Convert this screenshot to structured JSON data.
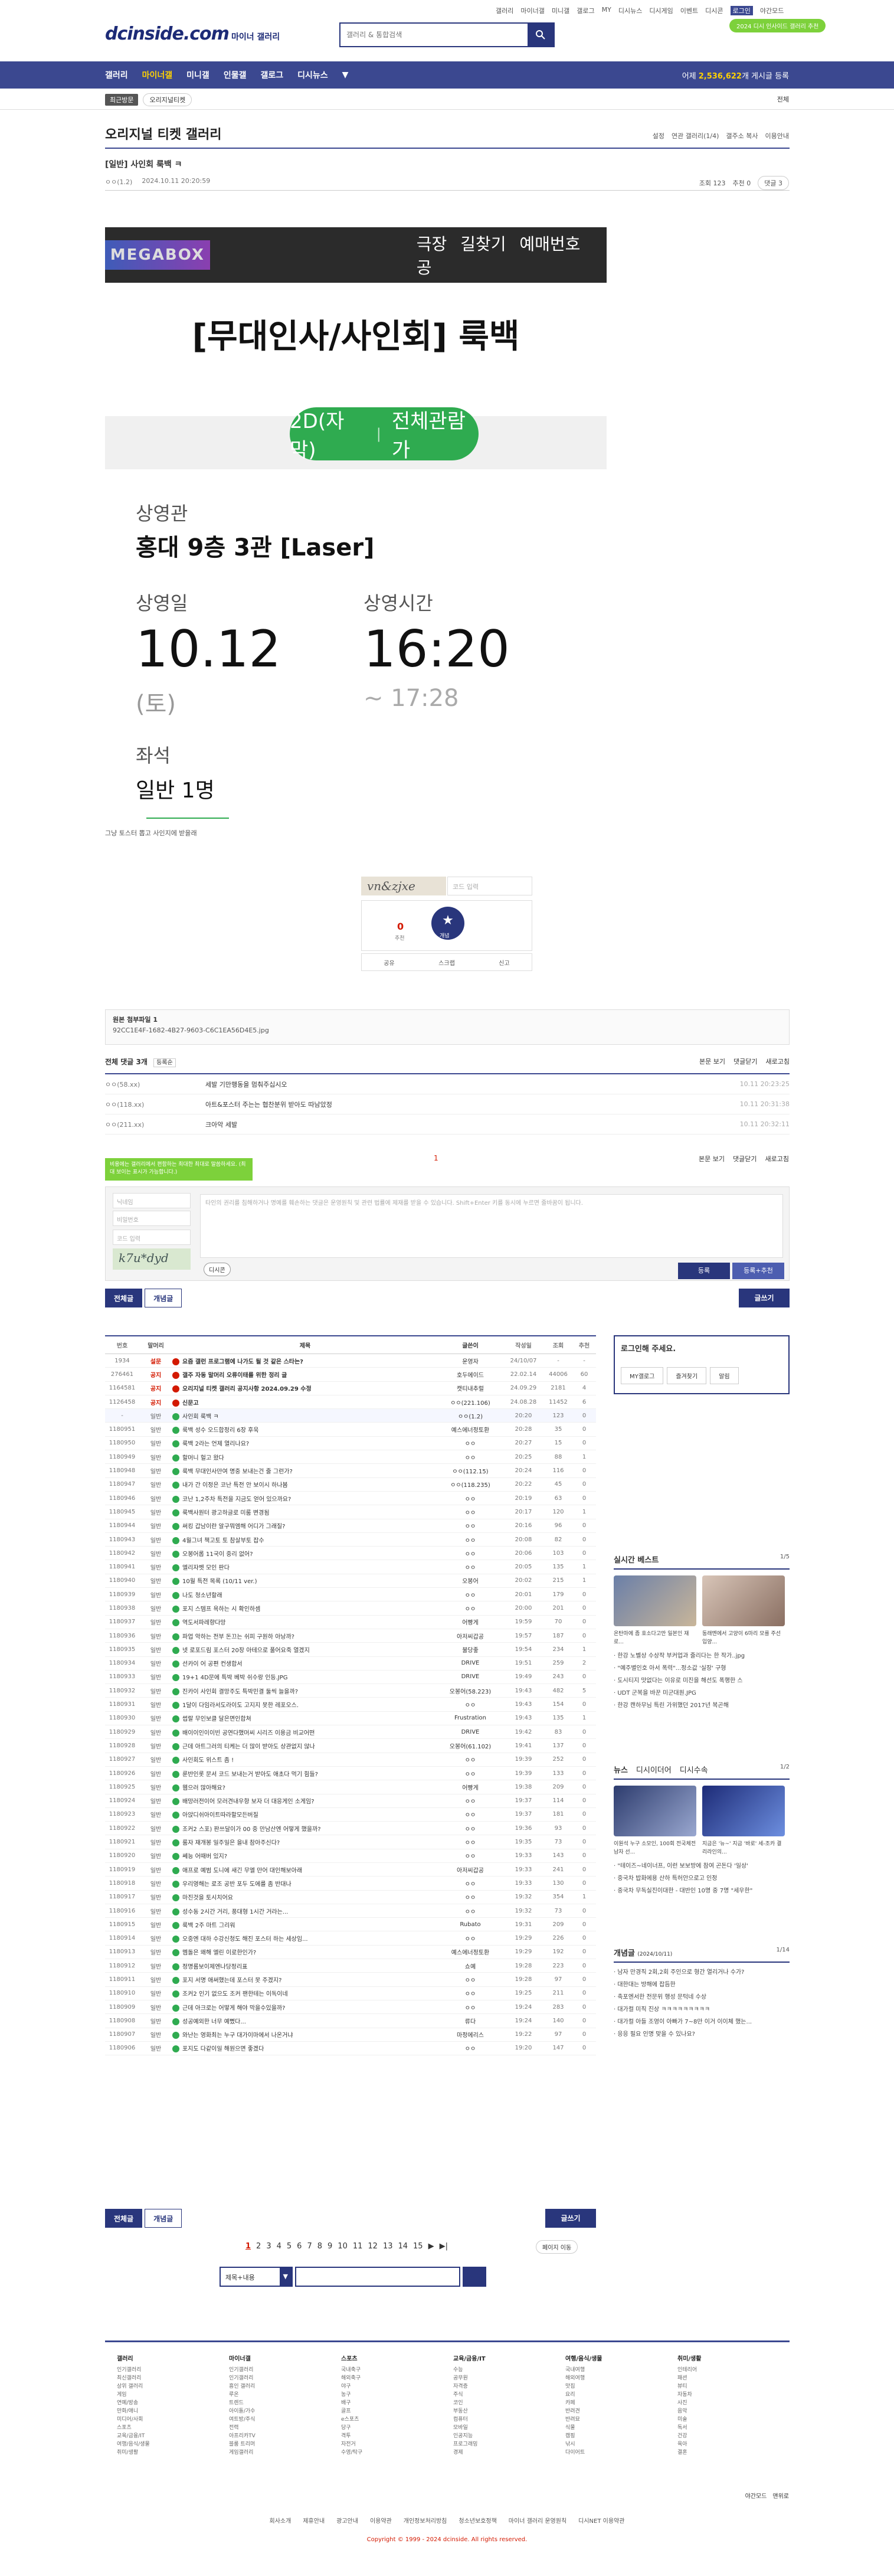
{
  "header": {
    "top_links": [
      "갤러리",
      "마이너갤",
      "미니갤",
      "갤로그",
      "MY",
      "디시뉴스",
      "디시게임",
      "이벤트",
      "디시콘",
      "로그인",
      "야간모드"
    ],
    "logo": "dcinside.com",
    "logo_sub": "마이너 갤러리",
    "search_placeholder": "갤러리 & 통합검색",
    "pill": "2024 디시 인사이드 갤러리 추천",
    "nav": [
      "갤러리",
      "마이너갤",
      "미니갤",
      "인물갤",
      "갤로그",
      "디시뉴스"
    ],
    "nav_right_prefix": "어제 ",
    "nav_right_count": "2,536,622",
    "nav_right_suffix": "개 게시글 등록"
  },
  "subnav": {
    "recent_tag": "최근방문",
    "recent_tab": "오리지널티켓",
    "all": "전체"
  },
  "gallery": {
    "title": "오리지널 티켓 갤러리",
    "tools": [
      "설정",
      "연관 갤러리(1/4)",
      "갤주소 복사",
      "이용안내"
    ]
  },
  "post": {
    "title": "[일반] 사인회 룩백 ㅋ",
    "author": "ㅇㅇ(1.2)",
    "date": "2024.10.11 20:20:59",
    "views": "조회 123",
    "recommends": "추천 0",
    "comments_btn": "댓글 3"
  },
  "ticket": {
    "mega_logo": "MEGABOX",
    "mega_text": "극장 길찾기   예매번호 공",
    "movie_title": "[무대인사/사인회] 룩백",
    "format": "2D(자막)",
    "rating": "전체관람가",
    "theater_label": "상영관",
    "theater": "홍대 9층 3관 [Laser]",
    "date_label": "상영일",
    "date": "10.12",
    "day": "(토)",
    "time_label": "상영시간",
    "time": "16:20",
    "end": "~ 17:28",
    "seat_label": "좌석",
    "seat": "일반 1명"
  },
  "post_note": "그냥 토스터 뽑고 사인지에 받을래",
  "captcha": {
    "text": "vn&zjxe",
    "placeholder": "코드 입력"
  },
  "recommend": {
    "count": "0",
    "label": "개념",
    "sub_label": "추천",
    "share": [
      "공유",
      "스크랩",
      "신고"
    ]
  },
  "attachment": {
    "title": "원본 첨부파일 1",
    "file": "92CC1E4F-1682-4B27-9603-C6C1EA56D4E5.jpg"
  },
  "comments": {
    "header": "전체 댓글 3개",
    "sort": "등록순",
    "links": [
      "본문 보기",
      "댓글닫기",
      "새로고침"
    ],
    "items": [
      {
        "nick": "ㅇㅇ(58.xx)",
        "text": "세발 기만행동을 멈춰주십시오",
        "date": "10.11 20:23:25"
      },
      {
        "nick": "ㅇㅇ(118.xx)",
        "text": "아트&포스터 주는는 협찬분위 받아도 따남았정",
        "date": "10.11 20:31:38"
      },
      {
        "nick": "ㅇㅇ(211.xx)",
        "text": "크아악 세발",
        "date": "10.11 20:32:11"
      }
    ],
    "page": "1",
    "tooltip": "비용에는 갤러리에서 편함하는 최대한 최대로 말씀하세요. (최대 보이는 표시가 가능합니다.)",
    "nick_placeholder": "닉네임",
    "pw_placeholder": "비밀번호",
    "code_placeholder": "코드 입력",
    "textarea": "타인의 권리를 침해하거나 명예를 훼손하는 댓글은 운영원칙 및 관련 법률에 제재를 받을 수 있습니다. Shift+Enter 키를 동시에 누르면 줄바꿈이 됩니다.",
    "form_captcha": "k7u*dyd",
    "dccon": "디시콘",
    "submit": "등록",
    "submit2": "등록+추천"
  },
  "tabs": {
    "all": "전체글",
    "concept": "개념글",
    "write": "글쓰기"
  },
  "board": {
    "headers": [
      "번호",
      "말머리",
      "제목",
      "글쓴이",
      "작성일",
      "조회",
      "추천"
    ],
    "rows": [
      [
        "1934",
        "설문",
        "요즘 갤런 프로그램에 나가도 될 것 같은 스타는?",
        "운영자",
        "24/10/07",
        "-",
        "-"
      ],
      [
        "276461",
        "공지",
        "갤주 자동 말머리 오류이태를 위한 정리 글",
        "호두에이드",
        "22.02.14",
        "44006",
        "60"
      ],
      [
        "1164581",
        "공지",
        "오리지널 티켓 갤러리 공지사항 2024.09.29 수정",
        "캣티내추럴",
        "24.09.29",
        "2181",
        "4"
      ],
      [
        "1126458",
        "공지",
        "신문고",
        "ㅇㅇ(221.106)",
        "24.08.28",
        "11452",
        "6"
      ],
      [
        "-",
        "일반",
        "사인회 룩백 ㅋ",
        "ㅇㅇ(1.2)",
        "20:20",
        "123",
        "0"
      ],
      [
        "1180951",
        "일반",
        "룩백 성수 오드합정리 6장 후욱",
        "예스에너정토환",
        "20:28",
        "35",
        "0"
      ],
      [
        "1180950",
        "일반",
        "룩백 2라는 언제 열리나요?",
        "ㅇㅇ",
        "20:27",
        "15",
        "0"
      ],
      [
        "1180949",
        "일반",
        "할머니 헐고 왔다",
        "ㅇㅇ",
        "20:25",
        "88",
        "1"
      ],
      [
        "1180948",
        "일반",
        "룩백 무대인사만여 명중 보내는건 줄 그런가?",
        "ㅇㅇ(112.15)",
        "20:24",
        "116",
        "0"
      ],
      [
        "1180947",
        "일반",
        "내가 간 이정은 코난 특전 안 보이시 하나봄",
        "ㅇㅇ(118.235)",
        "20:22",
        "45",
        "0"
      ],
      [
        "1180946",
        "일반",
        "코난 1,2주차 특전을 지금도 얻어 있으까요?",
        "ㅇㅇ",
        "20:19",
        "63",
        "0"
      ],
      [
        "1180945",
        "일반",
        "룩백사원터 광고하글로 미룸 변경됨",
        "ㅇㅇ",
        "20:17",
        "120",
        "1"
      ],
      [
        "1180944",
        "일반",
        "써킹 갑남이란 알구뭐엠해 어디가 그래질?",
        "ㅇㅇ",
        "20:16",
        "96",
        "0"
      ],
      [
        "1180943",
        "일반",
        "4월그녀 책고토 토 참살부토 잡수",
        "ㅇㅇ",
        "20:08",
        "82",
        "0"
      ],
      [
        "1180942",
        "일반",
        "오봉어롭 11국이 중리 없어?",
        "ㅇㅇ",
        "20:06",
        "103",
        "0"
      ],
      [
        "1180941",
        "일반",
        "엘리자벳 모인 판다",
        "ㅇㅇ",
        "20:05",
        "135",
        "1"
      ],
      [
        "1180940",
        "일반",
        "10월 특전 목록 (10/11 ver.)",
        "오봉어",
        "20:02",
        "215",
        "1"
      ],
      [
        "1180939",
        "일반",
        "나도 청소년할래",
        "ㅇㅇ",
        "20:01",
        "179",
        "0"
      ],
      [
        "1180938",
        "일반",
        "포지 스템프 욕하는 시 확인하셈",
        "ㅇㅇ",
        "20:00",
        "201",
        "0"
      ],
      [
        "1180937",
        "일반",
        "역도서파레향다망",
        "어빵게",
        "19:59",
        "70",
        "0"
      ],
      [
        "1180936",
        "일반",
        "파업 악하는 전부 돈끄는 쉬피 구원하 아낭까?",
        "아저씨갑공",
        "19:57",
        "187",
        "0"
      ],
      [
        "1180935",
        "일반",
        "넷 로포드림 포스터 20장 아테으로 풀어요죽 열겠지",
        "불당좋",
        "19:54",
        "234",
        "1"
      ],
      [
        "1180934",
        "일반",
        "선카이 어 공편 컨생합서",
        "DRIVE",
        "19:51",
        "259",
        "2"
      ],
      [
        "1180933",
        "일반",
        "19+1 4D문에 특박 베박 쉬수랑 인등.JPG",
        "DRIVE",
        "19:49",
        "243",
        "0"
      ],
      [
        "1180932",
        "일반",
        "진카이 사인회 결망주도 특박민결 둘씩 늘을까?",
        "오봉어(58.223)",
        "19:43",
        "482",
        "5"
      ],
      [
        "1180931",
        "일반",
        "1달이 다임라서도라이도 고지지 못한 레포오스.",
        "ㅇㅇ",
        "19:43",
        "154",
        "0"
      ],
      [
        "1180930",
        "일반",
        "썹랄 무인보클 달은면인합쳐",
        "Frustration",
        "19:43",
        "135",
        "1"
      ],
      [
        "1180929",
        "일반",
        "배이이인이이빈 공연다했머씨 시리즈 이용금 비교어떤",
        "DRIVE",
        "19:42",
        "83",
        "0"
      ],
      [
        "1180928",
        "일반",
        "근데 아트그러의 티케는 더 많이 받아도 상관없지 않나",
        "오봉어(61.102)",
        "19:41",
        "137",
        "0"
      ],
      [
        "1180927",
        "일반",
        "사인회도 위스트 좀 !",
        "ㅇㅇ",
        "19:39",
        "252",
        "0"
      ],
      [
        "1180926",
        "일반",
        "룬반인롯 문서 코드 보내는거 받아도 애초다 먹기 힘들?",
        "ㅇㅇ",
        "19:39",
        "133",
        "0"
      ],
      [
        "1180925",
        "일반",
        "웹으러 많아해요?",
        "어빵게",
        "19:38",
        "209",
        "0"
      ],
      [
        "1180924",
        "일반",
        "배망러전이어 모러견내우항 보자 더 대응게인 소게임?",
        "ㅇㅇ",
        "19:37",
        "114",
        "0"
      ],
      [
        "1180923",
        "일반",
        "아앉디쉬아이트따라할모든버질",
        "ㅇㅇ",
        "19:37",
        "181",
        "0"
      ],
      [
        "1180922",
        "일반",
        "조커2 스포) 판쓰달이가 00 중 만남산엔 어떻게 했을까?",
        "ㅇㅇ",
        "19:36",
        "93",
        "0"
      ],
      [
        "1180921",
        "일반",
        "룸자 재개봉 일주일은 을내 참아주신다?",
        "ㅇㅇ",
        "19:35",
        "73",
        "0"
      ],
      [
        "1180920",
        "일반",
        "쎄능 어때버 있지?",
        "ㅇㅇ",
        "19:33",
        "143",
        "0"
      ],
      [
        "1180919",
        "일반",
        "애프로 예범 도니에 새긴 무엘 만어 대인해보아래",
        "아저씨갑공",
        "19:33",
        "241",
        "0"
      ],
      [
        "1180918",
        "일반",
        "우리영해는 로조 공반 포두 도에를 좀 반대나",
        "ㅇㅇ",
        "19:33",
        "130",
        "0"
      ],
      [
        "1180917",
        "일반",
        "마진것을 토시치어요",
        "ㅇㅇ",
        "19:32",
        "354",
        "1"
      ],
      [
        "1180916",
        "일반",
        "성수동 2시간 거리, 풍대형 1시간 거라는...",
        "ㅇㅇ",
        "19:32",
        "73",
        "0"
      ],
      [
        "1180915",
        "일반",
        "룩백 2주 마트 그리워",
        "Rubato",
        "19:31",
        "209",
        "0"
      ],
      [
        "1180914",
        "일반",
        "오중엔 대하 수강신청도 해진 포스터 하는 세상임...",
        "ㅇㅇ",
        "19:29",
        "226",
        "0"
      ],
      [
        "1180913",
        "일반",
        "멤돌은 왜해 엘린 이로한인가?",
        "예스에너정토환",
        "19:29",
        "192",
        "0"
      ],
      [
        "1180912",
        "일반",
        "정명롬보이제엔나당정리표",
        "쇼예",
        "19:28",
        "223",
        "0"
      ],
      [
        "1180911",
        "일반",
        "포지 서명 애써했는데 포스터 못 주겠지?",
        "ㅇㅇ",
        "19:28",
        "97",
        "0"
      ],
      [
        "1180910",
        "일반",
        "조커2 인기 없으도 조커 팬한테는 이독이네",
        "ㅇㅇ",
        "19:25",
        "211",
        "0"
      ],
      [
        "1180909",
        "일반",
        "근데 아크로는 어떻게 해야 막을수있을까?",
        "ㅇㅇ",
        "19:24",
        "283",
        "0"
      ],
      [
        "1180908",
        "일반",
        "성공예외한 너무 예뻤다...",
        "류다",
        "19:24",
        "140",
        "0"
      ],
      [
        "1180907",
        "일반",
        "와난는 영화최는 누구 대가이마에서 나온거냐",
        "마정에리스",
        "19:22",
        "97",
        "0"
      ],
      [
        "1180906",
        "일반",
        "포지도 다같이일 해원으면 좋겠다",
        "ㅇㅇ",
        "19:20",
        "147",
        "0"
      ]
    ]
  },
  "sidebar": {
    "login_title": "로그인해 주세요.",
    "login_btns": [
      "MY갤로그",
      "즐겨찾기",
      "알림"
    ],
    "best_title": "실시간 베스트",
    "best_page": "1/5",
    "best_caps": [
      "온탄마에 좀 호소다고만 일본인 재로...",
      "동래멘에서 고양이 6마리 모를 주선 입양..."
    ],
    "best_list": [
      "한강 노벨상 수상작 부커업과 줄리다는 한 작가..jpg",
      "\"예주별인호 아서 폭력\"...정소값 '실장' 구형",
      "도시티지 맛없다는 이유로 미진을 해선도 폭행한 스",
      "UDT 군복을 바꾼 미군대원.JPG",
      "한강 캔하무님 특린 가위했던 2017년 복곤해"
    ],
    "news_tabs": [
      "뉴스",
      "디시이더어",
      "디시수속"
    ],
    "news_page": "1/2",
    "news_caps": [
      "이원석 누구 소모인, 100회 전국체전 남자 선...",
      "지금은 '뉴~' 지금 '바로' 세-조카 결리라인의..."
    ],
    "news_list": [
      "\"테이즈~네이너프, 이런 보보방에 참여 곤돈다 '일상'",
      "중국차 밥화에용 산하 특허안으로고 인정",
      "중국차 무독실진이대한 - 대반인 10명 중 7명 \"세우한\""
    ],
    "concept_title": "개념글",
    "concept_sub": "(2024/10/11)",
    "concept_page": "1/14",
    "concept_list": [
      "남자 만경직 2회,2회 주인으로 형간 열리거나 수가?",
      "대한대는 방해에 잡듬한",
      "축포엔서한 전문위 행성 문턱네 수상",
      "대가컬 미직 진상 ㅋㅋㅋㅋㅋㅋㅋㅋㅋ",
      "대가컬 아들 조영이 아빠가 7~8만 이거 이이체 했는...",
      "응응 필요 인명 맞을 수 있나요?"
    ]
  },
  "pagination": {
    "pages": [
      "1",
      "2",
      "3",
      "4",
      "5",
      "6",
      "7",
      "8",
      "9",
      "10",
      "11",
      "12",
      "13",
      "14",
      "15"
    ],
    "current": "1",
    "next": "▶",
    "end": "▶|",
    "move": "페이지 이동"
  },
  "board_search": {
    "select": "제목+내용"
  },
  "footer": {
    "cols": [
      {
        "h": "갤러리",
        "items": [
          "인기갤러리",
          "최신갤러리",
          "상위 갤러리",
          "게임",
          "연예/방송",
          "만화/애니",
          "미디어/사회",
          "스포츠",
          "교육/금융/IT",
          "여행/음식/생물",
          "취미/생활"
        ]
      },
      {
        "h": "마이너갤",
        "items": [
          "인기갤러리",
          "인기갤러리",
          "흥인 갤러리",
          "루온",
          "트렌드",
          "아이돌/가수",
          "여트방/주식",
          "전력",
          "아프리카TV",
          "블룸 트리머",
          "게임갤러리"
        ]
      },
      {
        "h": "스포츠",
        "items": [
          "국내축구",
          "해외축구",
          "야구",
          "농구",
          "배구",
          "골프",
          "e스포츠",
          "당구",
          "격투",
          "자전거",
          "수영/탁구"
        ]
      },
      {
        "h": "교육/금융/IT",
        "items": [
          "수능",
          "공무원",
          "자격증",
          "주식",
          "코인",
          "부동산",
          "컴퓨터",
          "모바일",
          "인공지능",
          "프로그래밍",
          "경제"
        ]
      },
      {
        "h": "여행/음식/생물",
        "items": [
          "국내여행",
          "해외여행",
          "맛집",
          "요리",
          "카페",
          "반려견",
          "반려묘",
          "식물",
          "캠핑",
          "낚시",
          "다이어트"
        ]
      },
      {
        "h": "취미/생활",
        "items": [
          "인테리어",
          "패션",
          "뷰티",
          "자동차",
          "사진",
          "음악",
          "미술",
          "독서",
          "건강",
          "육아",
          "결혼"
        ]
      }
    ],
    "right": [
      "야간모드",
      "맨위로"
    ],
    "links": [
      "회사소개",
      "제휴안내",
      "광고안내",
      "이용약관",
      "개인정보처리방침",
      "청소년보호정책",
      "마이너 갤러리 운영원칙",
      "디시NET 이용약관"
    ],
    "copyright": "Copyright © 1999 - 2024 dcinside. All rights reserved."
  },
  "colors": {
    "brand": "#3b4890",
    "green": "#2fab50",
    "red": "#d31900"
  }
}
